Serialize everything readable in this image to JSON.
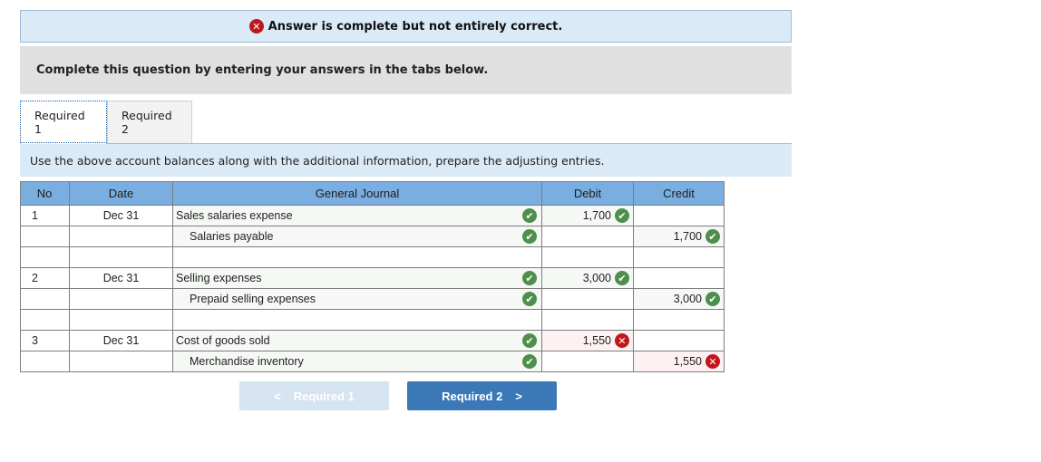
{
  "banner": {
    "status_icon": "error-x-icon",
    "message": "Answer is complete but not entirely correct."
  },
  "instructions": "Complete this question by entering your answers in the tabs below.",
  "tabs": [
    {
      "label": "Required 1",
      "active": true
    },
    {
      "label": "Required 2",
      "active": false
    }
  ],
  "directions": "Use the above account balances along with the additional information, prepare the adjusting entries.",
  "journal": {
    "headers": {
      "no": "No",
      "date": "Date",
      "account": "General Journal",
      "debit": "Debit",
      "credit": "Credit"
    },
    "rows": [
      {
        "no": "1",
        "date": "Dec 31",
        "account": "Sales salaries expense",
        "indent": false,
        "account_status": "correct",
        "debit": "1,700",
        "debit_status": "correct",
        "credit": "",
        "credit_status": ""
      },
      {
        "no": "",
        "date": "",
        "account": "Salaries payable",
        "indent": true,
        "account_status": "correct",
        "debit": "",
        "debit_status": "",
        "credit": "1,700",
        "credit_status": "correct"
      },
      {
        "no": "",
        "date": "",
        "account": "",
        "indent": false,
        "account_status": "",
        "debit": "",
        "debit_status": "",
        "credit": "",
        "credit_status": ""
      },
      {
        "no": "2",
        "date": "Dec 31",
        "account": "Selling expenses",
        "indent": false,
        "account_status": "correct",
        "debit": "3,000",
        "debit_status": "correct",
        "credit": "",
        "credit_status": ""
      },
      {
        "no": "",
        "date": "",
        "account": "Prepaid selling expenses",
        "indent": true,
        "account_status": "correct",
        "debit": "",
        "debit_status": "",
        "credit": "3,000",
        "credit_status": "correct"
      },
      {
        "no": "",
        "date": "",
        "account": "",
        "indent": false,
        "account_status": "",
        "debit": "",
        "debit_status": "",
        "credit": "",
        "credit_status": ""
      },
      {
        "no": "3",
        "date": "Dec 31",
        "account": "Cost of goods sold",
        "indent": false,
        "account_status": "correct",
        "debit": "1,550",
        "debit_status": "incorrect",
        "credit": "",
        "credit_status": ""
      },
      {
        "no": "",
        "date": "",
        "account": "Merchandise inventory",
        "indent": true,
        "account_status": "correct",
        "debit": "",
        "debit_status": "",
        "credit": "1,550",
        "credit_status": "incorrect"
      }
    ]
  },
  "navigation": {
    "prev_label": "Required 1",
    "prev_enabled": false,
    "next_label": "Required 2",
    "next_enabled": true,
    "prev_icon": "chevron-left-icon",
    "next_icon": "chevron-right-icon"
  },
  "colors": {
    "correct": "#4e8f4d",
    "incorrect": "#c0171b",
    "header_bg": "#7aaee0",
    "banner_bg": "#dbeaf7",
    "primary_button": "#3a78b8"
  }
}
